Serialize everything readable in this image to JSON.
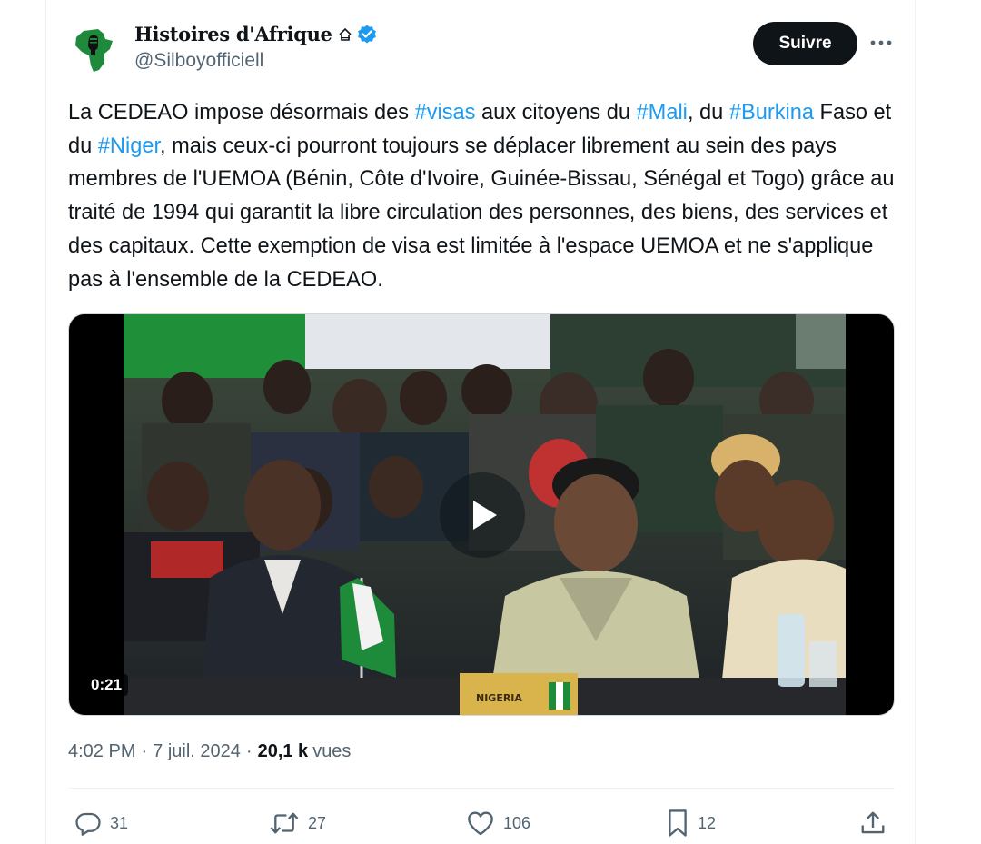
{
  "author": {
    "name": "Histoires d'Afrique",
    "handle": "@Silboyofficiell",
    "avatar_icon": "africa-map-fist-icon",
    "verified": true,
    "verified_color": "#1d9bf0"
  },
  "header": {
    "follow_label": "Suivre",
    "more_icon": "more-horizontal-icon"
  },
  "tweet": {
    "segments": [
      {
        "text": "La CEDEAO impose désormais des ",
        "hashtag": false
      },
      {
        "text": "#visas",
        "hashtag": true
      },
      {
        "text": " aux citoyens du ",
        "hashtag": false
      },
      {
        "text": "#Mali",
        "hashtag": true
      },
      {
        "text": ", du ",
        "hashtag": false
      },
      {
        "text": "#Burkina",
        "hashtag": true
      },
      {
        "text": " Faso et du ",
        "hashtag": false
      },
      {
        "text": "#Niger",
        "hashtag": true
      },
      {
        "text": ", mais ceux-ci pourront toujours se déplacer librement au sein des pays membres de l'UEMOA (Bénin, Côte d'Ivoire, Guinée-Bissau, Sénégal et Togo) grâce au traité de 1994 qui garantit la libre circulation des personnes, des biens, des services et des capitaux. Cette exemption de visa est limitée à l'espace UEMOA et ne s'applique pas à l'ensemble de la CEDEAO.",
        "hashtag": false
      }
    ],
    "hashtag_color": "#1d9bf0"
  },
  "media": {
    "duration": "0:21",
    "placard_text": "NIGERIA",
    "play_icon": "play-icon"
  },
  "meta": {
    "time": "4:02 PM",
    "date": "7 juil. 2024",
    "views_count": "20,1 k",
    "views_label": "vues"
  },
  "actions": {
    "replies": "31",
    "reposts": "27",
    "likes": "106",
    "bookmarks": "12",
    "icons": [
      "reply-icon",
      "repost-icon",
      "like-icon",
      "bookmark-icon",
      "share-icon"
    ]
  }
}
